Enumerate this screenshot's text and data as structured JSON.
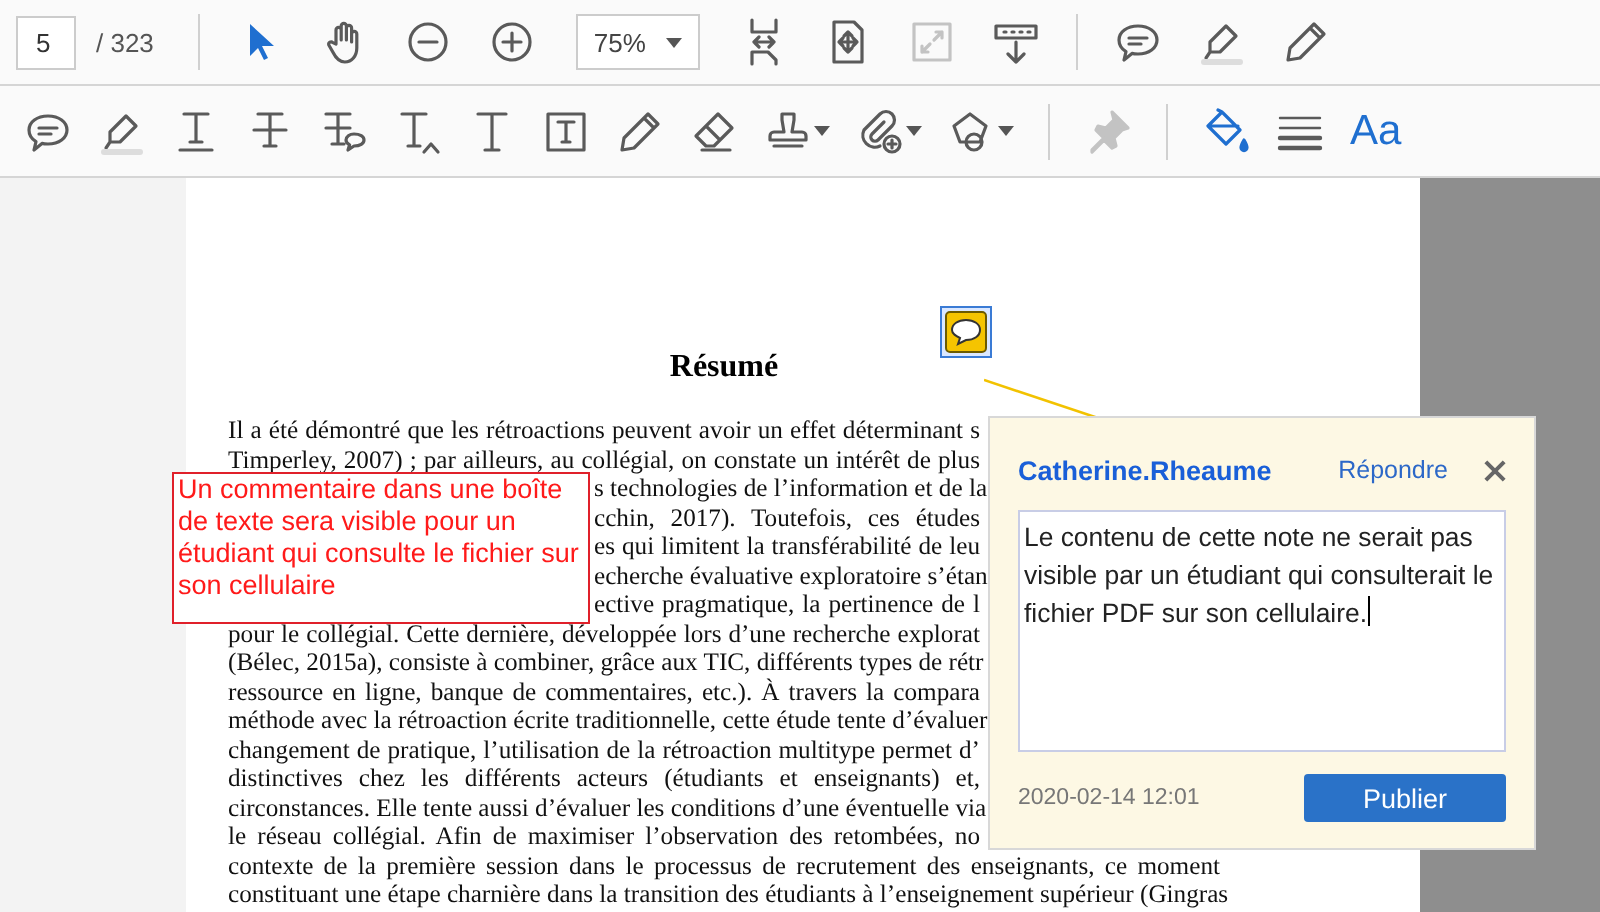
{
  "toolbar_top": {
    "page_field": {
      "value": "5"
    },
    "page_total": "/ 323",
    "tools": [
      {
        "kind": "separator"
      },
      {
        "kind": "select",
        "selected": true,
        "disabled": false
      },
      {
        "kind": "hand",
        "selected": false,
        "disabled": false
      },
      {
        "kind": "zoom-out",
        "selected": false,
        "disabled": false
      },
      {
        "kind": "zoom-in",
        "selected": false,
        "disabled": false
      },
      {
        "kind": "zoom-select",
        "value": "75%"
      },
      {
        "kind": "fit-width",
        "selected": false,
        "disabled": false
      },
      {
        "kind": "fit-page",
        "selected": false,
        "disabled": false
      },
      {
        "kind": "fullscreen",
        "selected": false,
        "disabled": true
      },
      {
        "kind": "read-mode",
        "selected": false,
        "disabled": false
      },
      {
        "kind": "separator"
      },
      {
        "kind": "comment",
        "selected": false,
        "disabled": false
      },
      {
        "kind": "highlight",
        "selected": false,
        "disabled": false
      },
      {
        "kind": "pencil",
        "selected": false,
        "disabled": false
      }
    ]
  },
  "toolbar_comment": {
    "tools": [
      {
        "kind": "comment",
        "menu": false,
        "disabled": false
      },
      {
        "kind": "highlight",
        "menu": false,
        "disabled": false
      },
      {
        "kind": "underline",
        "menu": false,
        "disabled": false
      },
      {
        "kind": "strikethrough",
        "menu": false,
        "disabled": false
      },
      {
        "kind": "replace-text",
        "menu": false,
        "disabled": false
      },
      {
        "kind": "insert-text",
        "menu": false,
        "disabled": false
      },
      {
        "kind": "add-text",
        "menu": false,
        "disabled": false
      },
      {
        "kind": "text-box",
        "menu": false,
        "disabled": false
      },
      {
        "kind": "pencil",
        "menu": false,
        "disabled": false
      },
      {
        "kind": "eraser",
        "menu": false,
        "disabled": false
      },
      {
        "kind": "stamp",
        "menu": true,
        "disabled": false
      },
      {
        "kind": "attach",
        "menu": true,
        "disabled": false
      },
      {
        "kind": "shapes",
        "menu": true,
        "disabled": false
      },
      {
        "kind": "separator"
      },
      {
        "kind": "pin",
        "menu": false,
        "disabled": true
      },
      {
        "kind": "separator"
      },
      {
        "kind": "fill",
        "menu": false,
        "disabled": false
      },
      {
        "kind": "line-style",
        "menu": false,
        "disabled": false
      },
      {
        "kind": "font",
        "label": "Aa",
        "disabled": false
      }
    ]
  },
  "document": {
    "title": "Résumé",
    "lines_top": [
      "Il a été démontré que les rétroactions peuvent avoir un effet déterminant s",
      "Timperley, 2007) ; par ailleurs, au collégial, on constate un intérêt de plus"
    ],
    "lines_beside_text_box": [
      "s technologies de l’information et de la",
      "cchin, 2017). Toutefois, ces études",
      "es qui limitent la transférabilité de leu",
      "echerche évaluative exploratoire s’étan",
      "ective pragmatique, la pertinence de l"
    ],
    "lines_beside_note": [
      "pour le collégial. Cette dernière, développée lors d’une recherche explorat",
      "(Bélec, 2015a), consiste à combiner, grâce aux TIC, différents types de rétr",
      "ressource en ligne, banque de commentaires, etc.). À travers la compara",
      "méthode avec la rétroaction écrite traditionnelle, cette étude tente d’évaluer",
      "changement de pratique, l’utilisation de la rétroaction multitype permet d’",
      "distinctives chez les différents acteurs (étudiants et enseignants) et,",
      "circonstances. Elle tente aussi d’évaluer les conditions d’une éventuelle via",
      "le réseau collégial. Afin de maximiser l’observation des retombées, no"
    ],
    "lines_bottom": [
      "contexte de la première session dans le processus de recrutement des enseignants, ce moment",
      "constituant une étape charnière dans la transition des étudiants à l’enseignement supérieur (Gingras"
    ]
  },
  "text_box_comment": "Un commentaire dans une boîte de texte sera visible pour un étudiant qui consulte le fichier sur son cellulaire",
  "note_popup": {
    "author": "Catherine.Rheaume",
    "reply": "Répondre",
    "text": "Le contenu de cette note ne serait pas visible par un étudiant qui consulterait le fichier PDF sur son cellulaire.",
    "date": "2020-02-14  12:01",
    "publish": "Publier"
  }
}
